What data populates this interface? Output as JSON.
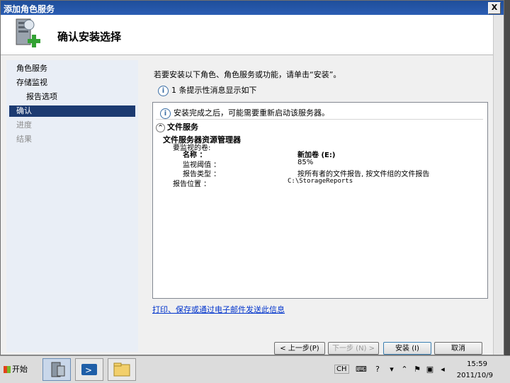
{
  "window": {
    "title": "添加角色服务",
    "close_label": "X"
  },
  "header": {
    "title": "确认安装选择",
    "icon": "server-add-icon"
  },
  "nav": {
    "items": [
      {
        "label": "角色服务",
        "state": "normal"
      },
      {
        "label": "存储监视",
        "state": "normal"
      },
      {
        "label": "报告选项",
        "state": "sub"
      },
      {
        "label": "确认",
        "state": "selected"
      },
      {
        "label": "进度",
        "state": "dim"
      },
      {
        "label": "结果",
        "state": "dim"
      }
    ]
  },
  "content": {
    "lead": "若要安装以下角色、角色服务或功能，请单击“安装”。",
    "notice_icon": "i",
    "notice": "1 条提示性消息显示如下",
    "box": {
      "message": "安装完成之后，可能需要重新启动该服务器。",
      "section_title": "文件服务",
      "subsection_title": "文件服务器资源管理器",
      "monitored_label": "要监视的卷:",
      "rows": [
        {
          "label": "名称 ：",
          "value": "新加卷 (E:)"
        },
        {
          "label": "监视阈值 ：",
          "value": "85%"
        },
        {
          "label": "报告类型 ：",
          "value": "按所有者的文件报告, 按文件组的文件报告"
        },
        {
          "label": "报告位置 ：",
          "value": "C:\\StorageReports"
        }
      ]
    },
    "link": "打印、保存或通过电子邮件发送此信息"
  },
  "buttons": {
    "back": "< 上一步(P)",
    "next": "下一步 (N) >",
    "install": "安装 (I)",
    "cancel": "取消"
  },
  "taskbar": {
    "start": "开始",
    "lang": "CH",
    "time": "15:59",
    "date": "2011/10/9"
  }
}
